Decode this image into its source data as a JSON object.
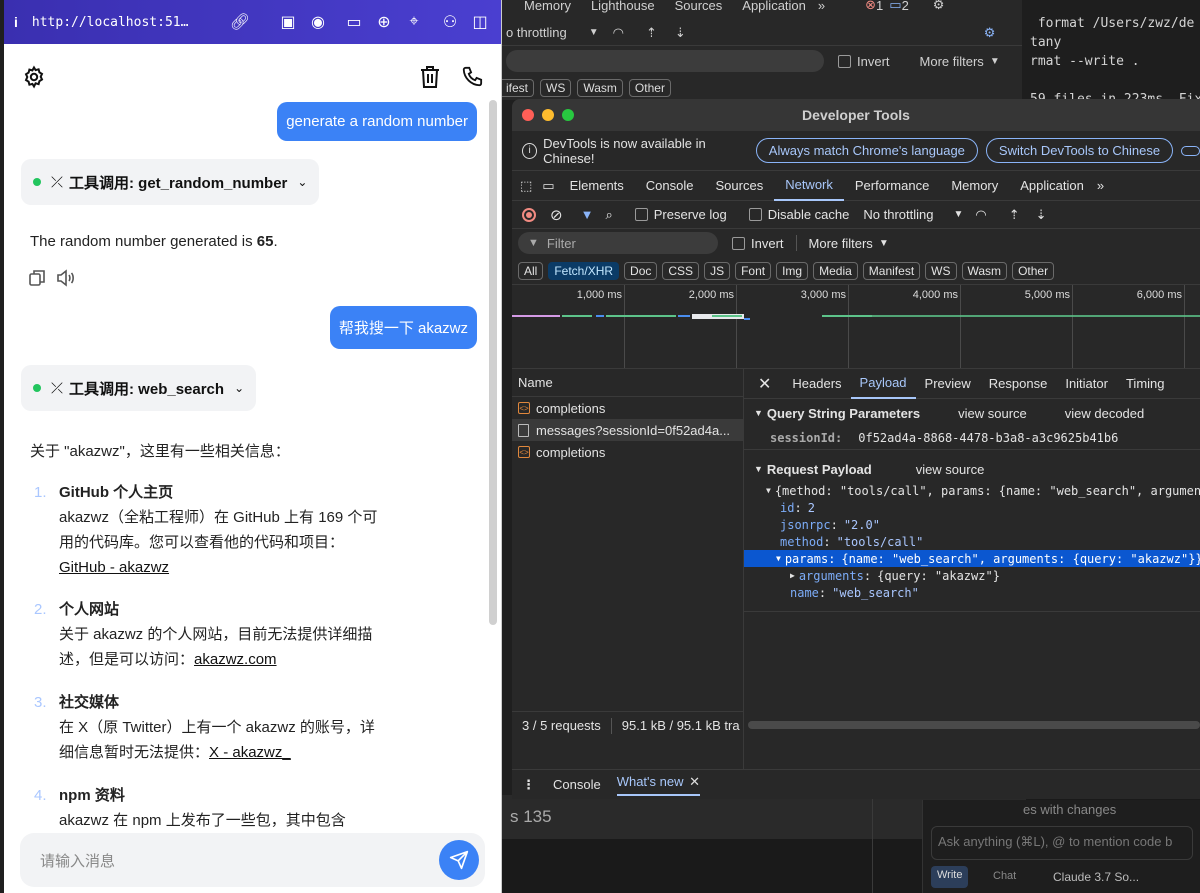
{
  "chat": {
    "url": "http://localhost:51…",
    "messages": {
      "user1": "generate a random number",
      "tool1": "工具调用: get_random_number",
      "assistant1_prefix": "The random number generated is ",
      "assistant1_value": "65",
      "assistant1_suffix": ".",
      "user2": "帮我搜一下 akazwz",
      "tool2": "工具调用: web_search",
      "assistant2_intro": "关于 \"akazwz\"，这里有一些相关信息："
    },
    "list": [
      {
        "num": "1.",
        "title": "GitHub 个人主页",
        "desc_line1": "akazwz（全粘工程师）在 GitHub 上有 169 个可",
        "desc_line2": "用的代码库。您可以查看他的代码和项目：",
        "link": "GitHub - akazwz"
      },
      {
        "num": "2.",
        "title": "个人网站",
        "desc_line1": "关于 akazwz 的个人网站，目前无法提供详细描",
        "desc_line2_prefix": "述，但是可以访问：",
        "link": "akazwz.com"
      },
      {
        "num": "3.",
        "title": "社交媒体",
        "desc_line1": "在 X（原 Twitter）上有一个 akazwz 的账号，详",
        "desc_line2_prefix": "细信息暂时无法提供：",
        "link": "X - akazwz_"
      },
      {
        "num": "4.",
        "title": "npm 资料",
        "desc_line1": "akazwz 在 npm 上发布了一些包，其中包含"
      }
    ],
    "input_placeholder": "请输入消息"
  },
  "bg": {
    "top_tabs": [
      "Memory",
      "Lighthouse",
      "Sources",
      "Application"
    ],
    "errors": "1",
    "messages_count": "2",
    "throttle": "o throttling",
    "invert": "Invert",
    "more_filters": "More filters",
    "types": [
      "ifest",
      "WS",
      "Wasm",
      "Other"
    ],
    "terminal": " format /Users/zwz/de\ntany\nrmat --write .\n\n59 files in 223ms. Fix",
    "lower_text": "s 135",
    "changes_text": "es with changes",
    "ask_placeholder": "Ask anything (⌘L), @ to mention code b",
    "write": "Write",
    "chat": "Chat",
    "model": "Claude 3.7 So..."
  },
  "devtools": {
    "title": "Developer Tools",
    "info_text": "DevTools is now available in Chinese!",
    "btn_match": "Always match Chrome's language",
    "btn_switch": "Switch DevTools to Chinese",
    "tabs": [
      "Elements",
      "Console",
      "Sources",
      "Network",
      "Performance",
      "Memory",
      "Application"
    ],
    "preserve_log": "Preserve log",
    "disable_cache": "Disable cache",
    "throttling": "No throttling",
    "filter_placeholder": "Filter",
    "invert": "Invert",
    "more_filters": "More filters",
    "types": [
      "All",
      "Fetch/XHR",
      "Doc",
      "CSS",
      "JS",
      "Font",
      "Img",
      "Media",
      "Manifest",
      "WS",
      "Wasm",
      "Other"
    ],
    "ticks": [
      "1,000 ms",
      "2,000 ms",
      "3,000 ms",
      "4,000 ms",
      "5,000 ms",
      "6,000 ms"
    ],
    "name_header": "Name",
    "requests": [
      "completions",
      "messages?sessionId=0f52ad4a...",
      "completions"
    ],
    "status": "3 / 5 requests",
    "transfer": "95.1 kB / 95.1 kB tra",
    "detail_tabs": [
      "Headers",
      "Payload",
      "Preview",
      "Response",
      "Initiator",
      "Timing"
    ],
    "qsp_title": "Query String Parameters",
    "view_source": "view source",
    "view_decoded": "view decoded",
    "session_key": "sessionId:",
    "session_val": "0f52ad4a-8868-4478-b3a8-a3c9625b41b6",
    "payload_title": "Request Payload",
    "summary_line": "{method: \"tools/call\", params: {name: \"web_search\", arguments",
    "id_key": "id",
    "id_val": "2",
    "jsonrpc_key": "jsonrpc",
    "jsonrpc_val": "\"2.0\"",
    "method_key": "method",
    "method_val": "\"tools/call\"",
    "params_key": "params",
    "params_val": "{name: \"web_search\", arguments: {query: \"akazwz\"}}",
    "arguments_key": "arguments",
    "arguments_val": "{query: \"akazwz\"}",
    "name_key": "name",
    "name_val": "\"web_search\"",
    "drawer_console": "Console",
    "drawer_whatsnew": "What's new"
  }
}
